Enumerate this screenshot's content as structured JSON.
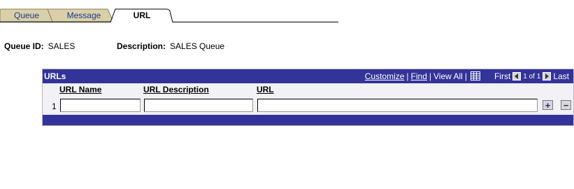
{
  "tabs": [
    {
      "label": "Queue",
      "active": false
    },
    {
      "label": "Message",
      "active": false
    },
    {
      "label": "URL",
      "active": true
    }
  ],
  "header": {
    "queue_id_label": "Queue ID:",
    "queue_id_value": "SALES",
    "description_label": "Description:",
    "description_value": "SALES Queue"
  },
  "grid": {
    "title": "URLs",
    "customize": "Customize",
    "find": "Find",
    "view_all": "View All",
    "first": "First",
    "position": "1 of 1",
    "last": "Last",
    "columns": [
      "URL Name",
      "URL Description",
      "URL"
    ],
    "rows": [
      {
        "num": "1",
        "url_name": "",
        "url_description": "",
        "url": ""
      }
    ],
    "add_row_symbol": "+",
    "delete_row_symbol": "−"
  },
  "colors": {
    "grid_header": "#333399",
    "tab_active": "#ffffff",
    "tab_inactive": "#d9cfa9",
    "link": "#1c3a8f"
  }
}
